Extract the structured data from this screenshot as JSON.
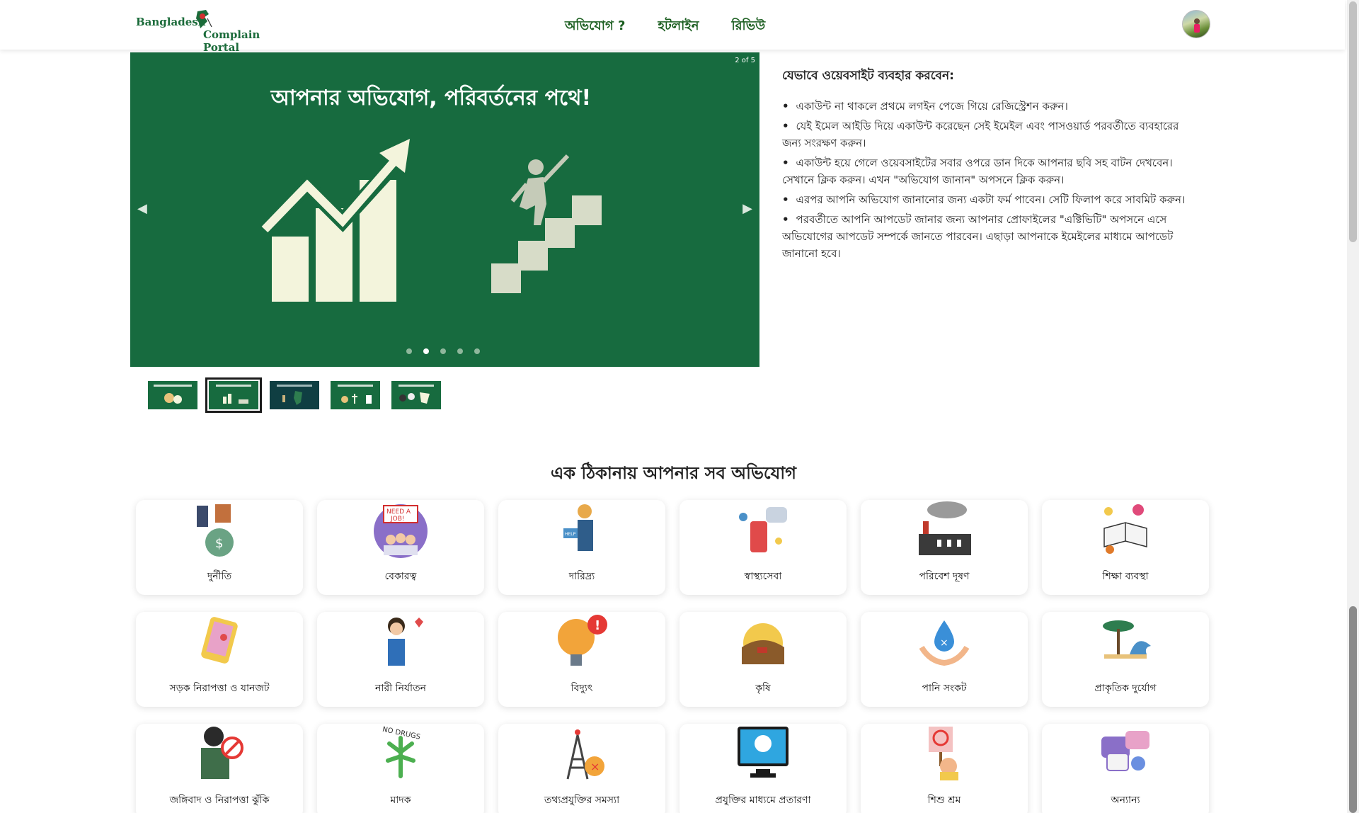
{
  "header": {
    "logo_line1": "Bangladesh",
    "logo_line2": "Complain Portal",
    "nav": [
      {
        "label": "অভিযোগ ?"
      },
      {
        "label": "হটলাইন"
      },
      {
        "label": "রিভিউ"
      }
    ]
  },
  "slider": {
    "counter": "2 of 5",
    "title": "আপনার অভিযোগ, পরিবর্তনের পথে!",
    "prev_arrow": "◀",
    "next_arrow": "▶",
    "slide_count": 5,
    "active_index": 1,
    "thumbnails": 5
  },
  "instructions": {
    "title": "যেভাবে ওয়েবসাইট ব্যবহার করবেন:",
    "bullet": "•",
    "items": [
      "একাউন্ট না থাকলে প্রথমে লগইন পেজে গিয়ে রেজিস্ট্রেশন করুন।",
      "যেই ইমেল আইডি দিয়ে একাউন্ট করেছেন সেই ইমেইল এবং পাসওয়ার্ড পরবর্তীতে ব্যবহারের জন্য সংরক্ষণ করুন।",
      "একাউন্ট হয়ে গেলে ওয়েবসাইটের সবার ওপরে ডান দিকে আপনার ছবি সহ বাটন দেখবেন। সেখানে ক্লিক করুন। এখন \"অভিযোগ জানান\" অপসনে ক্লিক করুন।",
      "এরপর আপনি অভিযোগ জানানোর জন্য একটা ফর্ম পাবেন। সেটি ফিলাপ করে সাবমিট করুন।",
      "পরবর্তীতে আপনি আপডেট জানার জন্য আপনার প্রোফাইলের \"এক্টিভিটি\" অপসনে এসে অভিযোগের আপডেট সম্পর্কে জানতে পারবেন। এছাড়া আপনাকে ইমেইলের মাধ্যমে আপডেট জানানো হবে।"
    ]
  },
  "categories": {
    "title": "এক ঠিকানায় আপনার সব অভিযোগ",
    "items": [
      {
        "label": "দুর্নীতি",
        "icon": "money-bag-icon"
      },
      {
        "label": "বেকারত্ব",
        "icon": "need-a-job-icon"
      },
      {
        "label": "দারিদ্র্য",
        "icon": "beggar-icon"
      },
      {
        "label": "স্বাস্থ্যসেবা",
        "icon": "medicine-icon"
      },
      {
        "label": "পরিবেশ দূষণ",
        "icon": "factory-icon"
      },
      {
        "label": "শিক্ষা ব্যবস্থা",
        "icon": "book-icon"
      },
      {
        "label": "সড়ক নিরাপত্তা ও যানজট",
        "icon": "map-phone-icon"
      },
      {
        "label": "নারী নির্যাতন",
        "icon": "crying-woman-icon"
      },
      {
        "label": "বিদ্যুৎ",
        "icon": "lightbulb-alert-icon"
      },
      {
        "label": "কৃষি",
        "icon": "farm-field-icon"
      },
      {
        "label": "পানি সংকট",
        "icon": "water-drop-hands-icon"
      },
      {
        "label": "প্রাকৃতিক দুর্যোগ",
        "icon": "tsunami-icon"
      },
      {
        "label": "জঙ্গিবাদ ও নিরাপত্তা ঝুঁকি",
        "icon": "terrorist-icon"
      },
      {
        "label": "মাদক",
        "icon": "no-drugs-icon"
      },
      {
        "label": "তথ্যপ্রযুক্তির সমস্যা",
        "icon": "tower-error-icon"
      },
      {
        "label": "প্রযুক্তির মাধ্যমে প্রতারণা",
        "icon": "skull-monitor-icon"
      },
      {
        "label": "শিশু শ্রম",
        "icon": "child-labour-icon"
      },
      {
        "label": "অন্যান্য",
        "icon": "chat-bubbles-icon"
      }
    ]
  }
}
